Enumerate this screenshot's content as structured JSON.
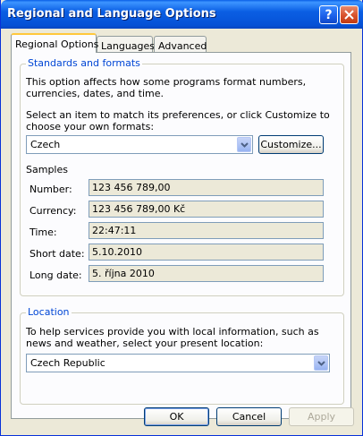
{
  "window": {
    "title": "Regional and Language Options"
  },
  "tabs": [
    {
      "label": "Regional Options",
      "active": true
    },
    {
      "label": "Languages",
      "active": false
    },
    {
      "label": "Advanced",
      "active": false
    }
  ],
  "standards": {
    "group_label": "Standards and formats",
    "description": "This option affects how some programs format numbers, currencies, dates, and time.",
    "select_prompt": "Select an item to match its preferences, or click Customize to choose your own formats:",
    "selected_format": "Czech",
    "customize_label": "Customize..."
  },
  "samples": {
    "heading": "Samples",
    "rows": [
      {
        "label": "Number:",
        "value": "123 456 789,00"
      },
      {
        "label": "Currency:",
        "value": "123 456 789,00 Kč"
      },
      {
        "label": "Time:",
        "value": "22:47:11"
      },
      {
        "label": "Short date:",
        "value": "5.10.2010"
      },
      {
        "label": "Long date:",
        "value": "5. října 2010"
      }
    ]
  },
  "location": {
    "group_label": "Location",
    "description": "To help services provide you with local information, such as news and weather, select your present location:",
    "selected_location": "Czech Republic"
  },
  "buttons": {
    "ok": "OK",
    "cancel": "Cancel",
    "apply": "Apply"
  },
  "colors": {
    "title_bar": "#0a5fe6",
    "group_label": "#0046d5",
    "tab_highlight": "#ffc83c",
    "window_bg": "#ece9d8"
  }
}
